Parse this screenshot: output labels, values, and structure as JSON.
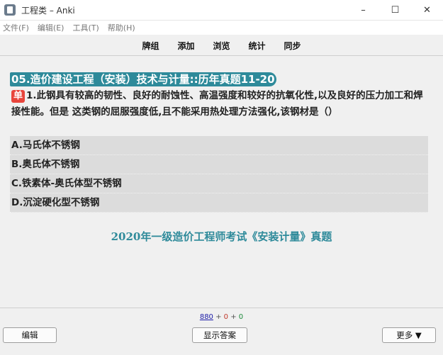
{
  "window": {
    "title": "工程类 – Anki",
    "minimize": "–",
    "maximize": "☐",
    "close": "✕"
  },
  "menubar": {
    "items": [
      "文件(F)",
      "编辑(E)",
      "工具(T)",
      "帮助(H)"
    ]
  },
  "toolbar": {
    "items": [
      "牌组",
      "添加",
      "浏览",
      "统计",
      "同步"
    ]
  },
  "card": {
    "deck_title": "05.造价建设工程（安装）技术与计量::历年真题11-20",
    "badge": "单",
    "question": "1.此钢具有较高的韧性、良好的耐蚀性、高温强度和较好的抗氧化性,以及良好的压力加工和焊接性能。但是 这类钢的屈服强度低,且不能采用热处理方法强化,该钢材是（）",
    "options": [
      "A.马氏体不锈钢",
      "B.奥氏体不锈钢",
      "C.铁素体-奥氏体型不锈钢",
      "D.沉淀硬化型不锈钢"
    ],
    "source_note": "2020年一级造价工程师考试《安装计量》真题"
  },
  "counts": {
    "new": "880",
    "sep1": " + ",
    "learn": "0",
    "sep2": " + ",
    "review": "0"
  },
  "buttons": {
    "edit": "编辑",
    "show_answer": "显示答案",
    "more": "更多 ▼"
  },
  "colors": {
    "accent": "#2e8a9a",
    "badge": "#e8453c",
    "option_bg": "#dcdcdc",
    "new_count": "#1a1aa6",
    "learn_count": "#c0392b",
    "review_count": "#1e8a3a"
  }
}
